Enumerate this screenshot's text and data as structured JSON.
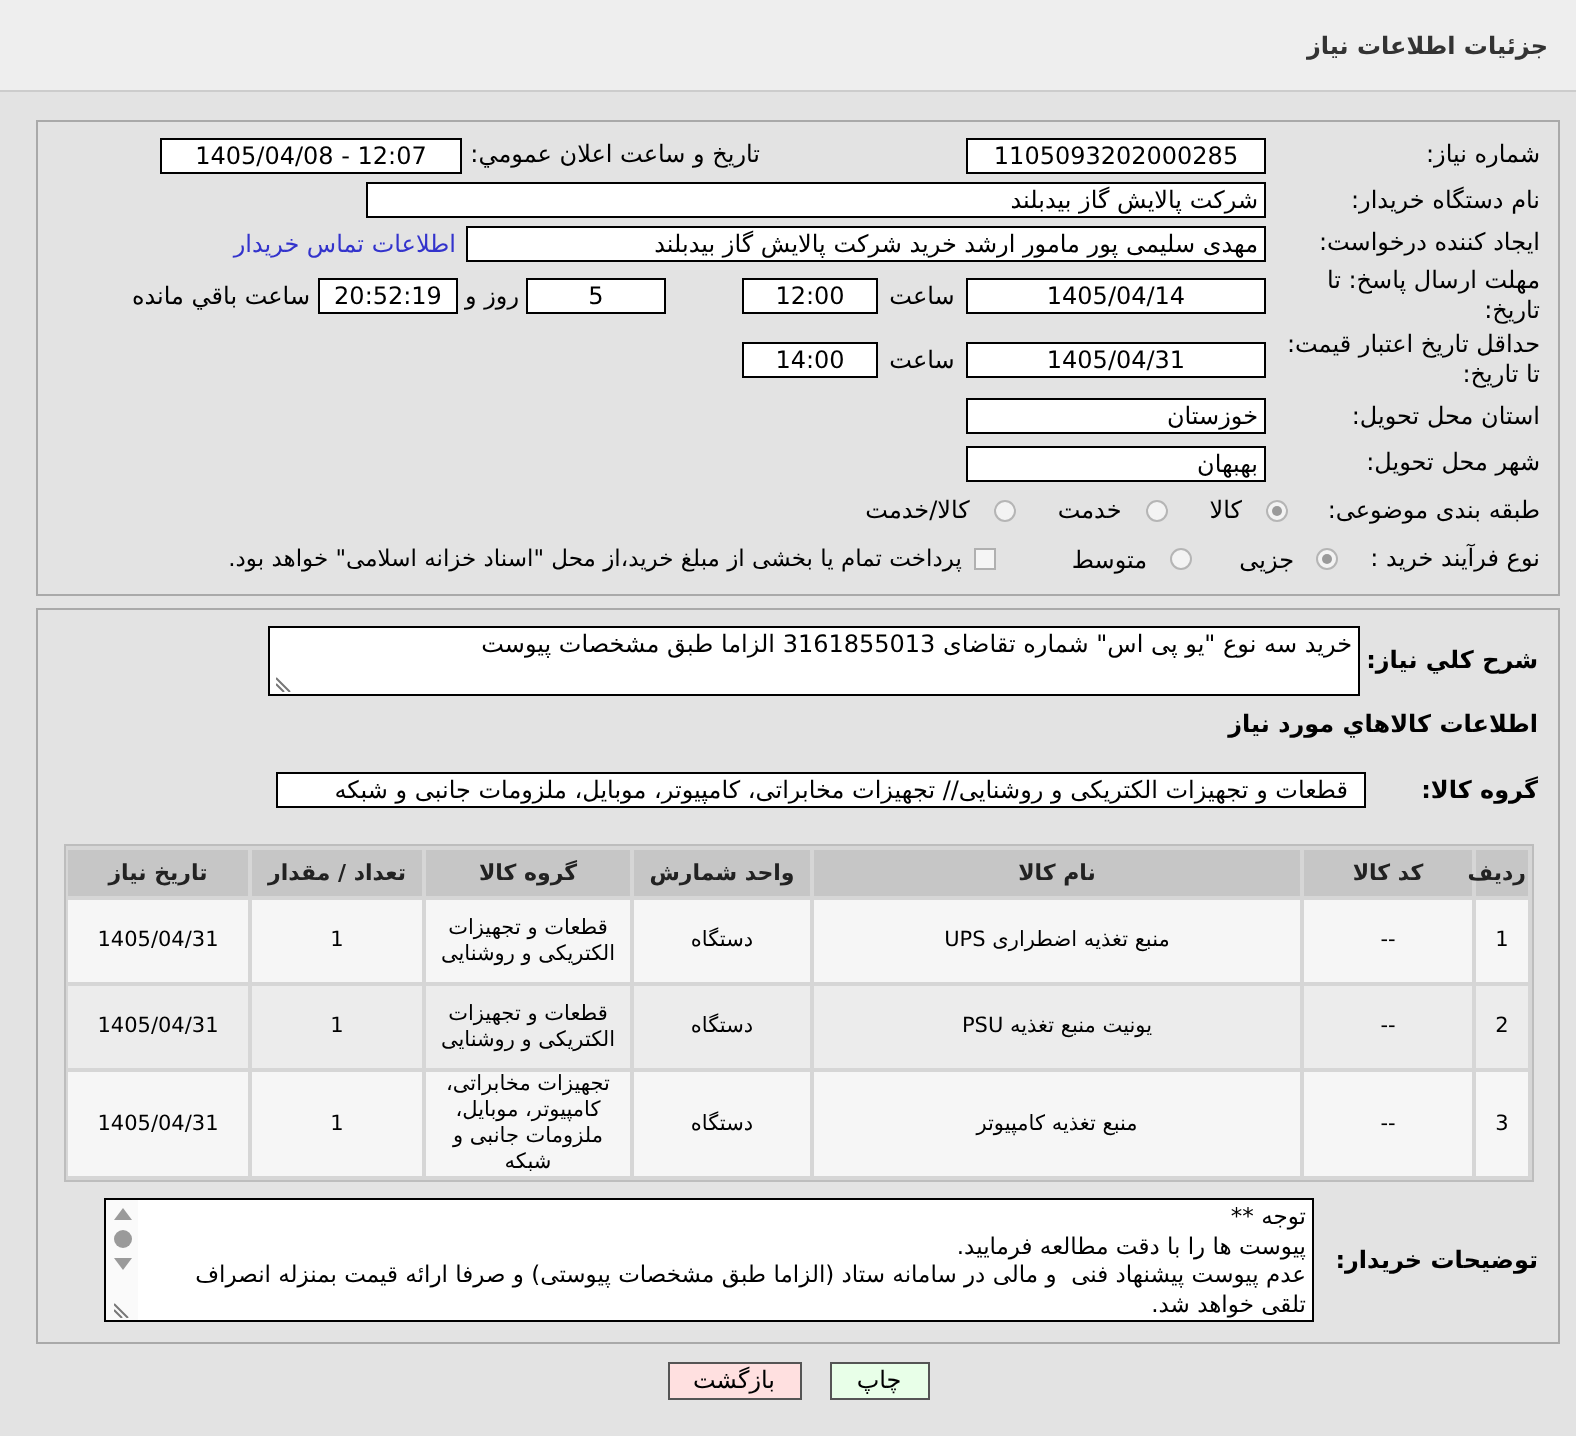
{
  "header": {
    "title": "جزئیات اطلاعات نیاز"
  },
  "need_number": {
    "label": "شماره نیاز:",
    "value": "1105093202000285"
  },
  "announcement": {
    "label": "تاریخ و ساعت اعلان عمومي:",
    "value": "1405/04/08 - 12:07"
  },
  "buyer_org": {
    "label": "نام دستگاه خریدار:",
    "value": "شرکت پالایش گاز بیدبلند"
  },
  "requester": {
    "label": "ایجاد کننده درخواست:",
    "value": "مهدی سلیمی پور مامور ارشد خرید شرکت پالایش گاز بیدبلند",
    "link": "اطلاعات تماس خریدار"
  },
  "reply_deadline": {
    "label": "مهلت ارسال پاسخ: تا تاریخ:",
    "date": "1405/04/14",
    "time_label": "ساعت",
    "time": "12:00",
    "days": "5",
    "days_label": "روز و",
    "remaining": "20:52:19",
    "remaining_label": "ساعت باقي مانده"
  },
  "price_validity": {
    "label": "حداقل تاریخ اعتبار قیمت: تا تاریخ:",
    "date": "1405/04/31",
    "time_label": "ساعت",
    "time": "14:00"
  },
  "province": {
    "label": "استان محل تحویل:",
    "value": "خوزستان"
  },
  "city": {
    "label": "شهر محل تحویل:",
    "value": "بهبهان"
  },
  "category": {
    "label": "طبقه بندی موضوعی:",
    "options": [
      {
        "label": "کالا",
        "selected": true
      },
      {
        "label": "خدمت",
        "selected": false
      },
      {
        "label": "کالا/خدمت",
        "selected": false
      }
    ]
  },
  "process": {
    "label": "نوع فرآیند خرید :",
    "options": [
      {
        "label": "جزیی",
        "selected": true
      },
      {
        "label": "متوسط",
        "selected": false
      }
    ],
    "treasury": {
      "label": "پرداخت تمام یا بخشی از مبلغ خرید،از محل \"اسناد خزانه اسلامی\" خواهد بود.",
      "checked": false
    }
  },
  "summary": {
    "label": "شرح كلي نياز:",
    "value": "خرید سه نوع \"یو پی اس\" شماره تقاضای 3161855013 الزاما طبق مشخصات پیوست"
  },
  "items_title": "اطلاعات كالاهاي مورد نياز",
  "goods_group": {
    "label": "گروه کالا:",
    "value": "قطعات و تجهیزات الکتریکی و روشنایی// تجهیزات مخابراتی، کامپیوتر، موبایل، ملزومات جانبی و شبکه"
  },
  "table": {
    "columns": [
      "ردیف",
      "کد کالا",
      "نام کالا",
      "واحد شمارش",
      "گروه کالا",
      "تعداد / مقدار",
      "تاریخ نیاز"
    ],
    "rows": [
      [
        "1",
        "--",
        "منبع تغذیه اضطراری UPS",
        "دستگاه",
        "قطعات و تجهیزات الکتریکی و روشنایی",
        "1",
        "1405/04/31"
      ],
      [
        "2",
        "--",
        "یونیت منبع تغذیه PSU",
        "دستگاه",
        "قطعات و تجهیزات الکتریکی و روشنایی",
        "1",
        "1405/04/31"
      ],
      [
        "3",
        "--",
        "منبع تغذیه کامپیوتر",
        "دستگاه",
        "تجهیزات مخابراتی، کامپیوتر، موبایل، ملزومات جانبی و شبکه",
        "1",
        "1405/04/31"
      ]
    ]
  },
  "buyer_notes": {
    "label": "توضیحات خریدار:",
    "value": "توجه **\nپیوست ها را با دقت مطالعه فرمایید.\nعدم پیوست پیشنهاد فنی  و مالی در سامانه ستاد (الزاما طبق مشخصات پیوستی) و صرفا ارائه قیمت بمنزله انصراف تلقی خواهد شد."
  },
  "buttons": [
    {
      "label": "چاپ",
      "kind": "print"
    },
    {
      "label": "بازگشت",
      "kind": "back"
    }
  ]
}
